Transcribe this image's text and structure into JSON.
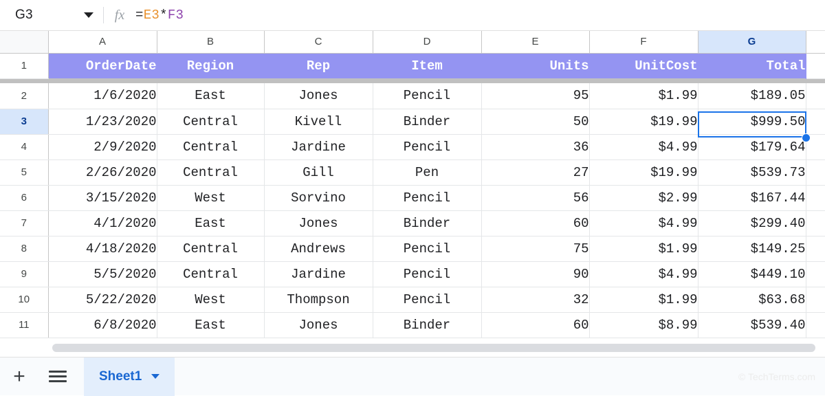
{
  "formula_bar": {
    "name_box_value": "G3",
    "fx_icon": "fx-icon",
    "formula_prefix": "=",
    "formula_ref1": "E3",
    "formula_operator": "*",
    "formula_ref2": "F3",
    "formula_full": "=E3*F3"
  },
  "grid": {
    "column_letters": [
      "A",
      "B",
      "C",
      "D",
      "E",
      "F",
      "G"
    ],
    "selected_column": "G",
    "selected_row": "3",
    "selected_cell": "G3",
    "row_numbers": [
      "1",
      "2",
      "3",
      "4",
      "5",
      "6",
      "7",
      "8",
      "9",
      "10",
      "11"
    ],
    "headers": [
      "OrderDate",
      "Region",
      "Rep",
      "Item",
      "Units",
      "UnitCost",
      "Total"
    ],
    "rows": [
      {
        "row": "2",
        "OrderDate": "1/6/2020",
        "Region": "East",
        "Rep": "Jones",
        "Item": "Pencil",
        "Units": "95",
        "UnitCost": "$1.99",
        "Total": "$189.05"
      },
      {
        "row": "3",
        "OrderDate": "1/23/2020",
        "Region": "Central",
        "Rep": "Kivell",
        "Item": "Binder",
        "Units": "50",
        "UnitCost": "$19.99",
        "Total": "$999.50"
      },
      {
        "row": "4",
        "OrderDate": "2/9/2020",
        "Region": "Central",
        "Rep": "Jardine",
        "Item": "Pencil",
        "Units": "36",
        "UnitCost": "$4.99",
        "Total": "$179.64"
      },
      {
        "row": "5",
        "OrderDate": "2/26/2020",
        "Region": "Central",
        "Rep": "Gill",
        "Item": "Pen",
        "Units": "27",
        "UnitCost": "$19.99",
        "Total": "$539.73"
      },
      {
        "row": "6",
        "OrderDate": "3/15/2020",
        "Region": "West",
        "Rep": "Sorvino",
        "Item": "Pencil",
        "Units": "56",
        "UnitCost": "$2.99",
        "Total": "$167.44"
      },
      {
        "row": "7",
        "OrderDate": "4/1/2020",
        "Region": "East",
        "Rep": "Jones",
        "Item": "Binder",
        "Units": "60",
        "UnitCost": "$4.99",
        "Total": "$299.40"
      },
      {
        "row": "8",
        "OrderDate": "4/18/2020",
        "Region": "Central",
        "Rep": "Andrews",
        "Item": "Pencil",
        "Units": "75",
        "UnitCost": "$1.99",
        "Total": "$149.25"
      },
      {
        "row": "9",
        "OrderDate": "5/5/2020",
        "Region": "Central",
        "Rep": "Jardine",
        "Item": "Pencil",
        "Units": "90",
        "UnitCost": "$4.99",
        "Total": "$449.10"
      },
      {
        "row": "10",
        "OrderDate": "5/22/2020",
        "Region": "West",
        "Rep": "Thompson",
        "Item": "Pencil",
        "Units": "32",
        "UnitCost": "$1.99",
        "Total": "$63.68"
      },
      {
        "row": "11",
        "OrderDate": "6/8/2020",
        "Region": "East",
        "Rep": "Jones",
        "Item": "Binder",
        "Units": "60",
        "UnitCost": "$8.99",
        "Total": "$539.40"
      }
    ]
  },
  "sheet_bar": {
    "add_sheet_icon": "plus-icon",
    "all_sheets_icon": "hamburger-icon",
    "tabs": [
      {
        "label": "Sheet1",
        "active": true
      }
    ]
  },
  "watermark": "© TechTerms.com",
  "colors": {
    "header_fill": "#9494f2",
    "header_text": "#ffffff",
    "selection_blue": "#1a73e8",
    "selected_header_fill": "#d7e6fb",
    "sheet_tab_fill": "#e3eefc",
    "sheet_tab_text": "#1967d2",
    "formula_ref1_color": "#e8912d",
    "formula_ref2_color": "#8e44ad"
  }
}
